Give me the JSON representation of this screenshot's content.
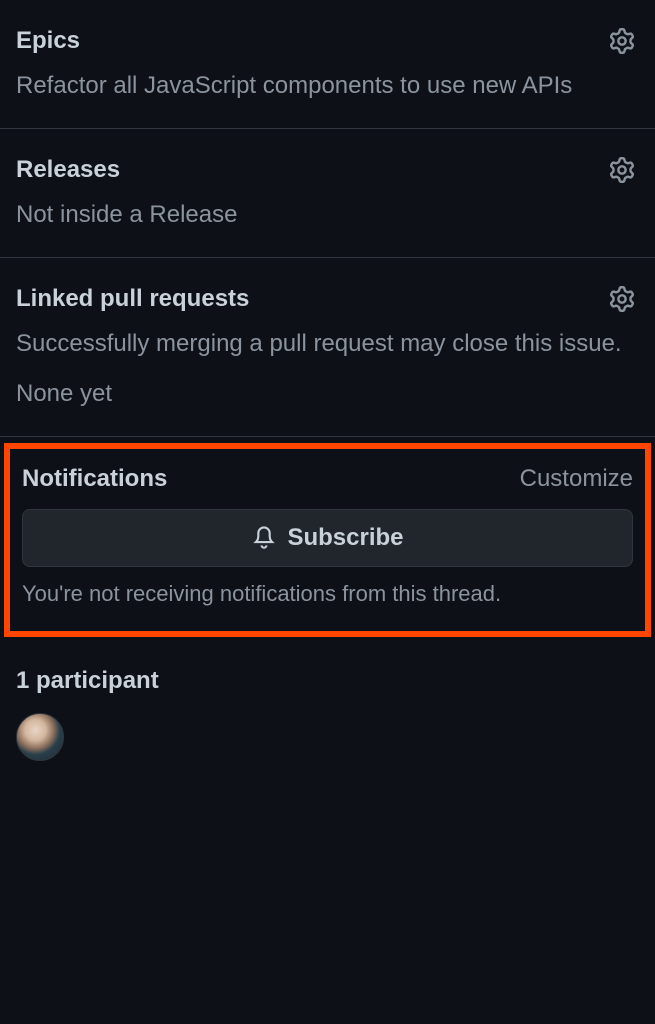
{
  "epics": {
    "title": "Epics",
    "content": "Refactor all JavaScript components to use new APIs"
  },
  "releases": {
    "title": "Releases",
    "content": "Not inside a Release"
  },
  "linkedPR": {
    "title": "Linked pull requests",
    "description": "Successfully merging a pull request may close this issue.",
    "status": "None yet"
  },
  "notifications": {
    "title": "Notifications",
    "customize": "Customize",
    "subscribeLabel": "Subscribe",
    "note": "You're not receiving notifications from this thread."
  },
  "participants": {
    "title": "1 participant"
  }
}
